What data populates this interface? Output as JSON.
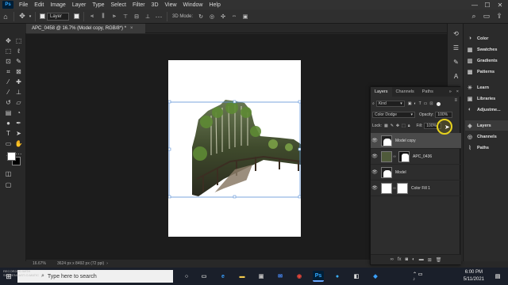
{
  "menubar": {
    "logo": "Ps",
    "items": [
      "File",
      "Edit",
      "Image",
      "Layer",
      "Type",
      "Select",
      "Filter",
      "3D",
      "View",
      "Window",
      "Help"
    ],
    "minimize": "—",
    "maximize": "☐",
    "close": "✕"
  },
  "optbar": {
    "auto_select_target": "Layer",
    "threed_mode": "3D Mode:"
  },
  "document_tab": {
    "title": "APC_0458 @ 16.7% (Model copy, RGB/8*) *",
    "close": "×"
  },
  "statusbar": {
    "zoom": "16.67%",
    "doc_info": "3624 px x 8492 px (72 ppi)"
  },
  "right_panels": {
    "items": [
      "Color",
      "Swatches",
      "Gradients",
      "Patterns",
      "Learn",
      "Libraries",
      "Adjustme...",
      "Layers",
      "Channels",
      "Paths"
    ]
  },
  "layers_panel": {
    "tabs": [
      "Layers",
      "Channels",
      "Paths"
    ],
    "filter_kind": "Kind",
    "blend_mode": "Color Dodge",
    "opacity_label": "Opacity:",
    "opacity_value": "100%",
    "lock_label": "Lock:",
    "fill_label": "Fill:",
    "fill_value": "100%",
    "layers": [
      {
        "name": "Model copy",
        "selected": true
      },
      {
        "name": "APC_0436",
        "selected": false
      },
      {
        "name": "Model",
        "selected": false
      },
      {
        "name": "Color Fill 1",
        "selected": false
      }
    ],
    "bottom_icons": [
      "link-icon",
      "fx-icon",
      "mask-icon",
      "adjustment-icon",
      "folder-icon",
      "new-layer-icon",
      "trash-icon"
    ]
  },
  "taskbar": {
    "search_placeholder": "Type here to search",
    "time": "6:00 PM",
    "date": "5/11/2021"
  },
  "watermark": {
    "line1": "RECORDED WITH",
    "line2": "SCREENCAST-O-MATIC"
  },
  "colors": {
    "accent": "#31a8ff",
    "highlight_ring": "#e6d21e"
  }
}
